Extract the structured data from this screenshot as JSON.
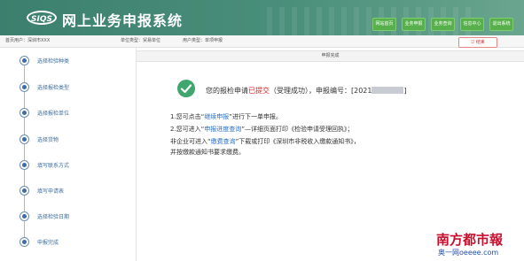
{
  "header": {
    "logo_text": "SIQS",
    "title": "网上业务申报系统",
    "buttons": [
      "网站首页",
      "业务申报",
      "业务查询",
      "信息中心",
      "退出系统"
    ]
  },
  "subbar": {
    "items": [
      "首页用户：深圳市XXX",
      "单位类型：贸易单位",
      "用户类型：单项申报"
    ],
    "exit_label": "结束"
  },
  "sidebar": {
    "steps": [
      "选择检验种类",
      "选择报检类型",
      "选择报检单位",
      "选择货物",
      "填写联系方式",
      "填写申请表",
      "选择检验日期",
      "申报完成"
    ]
  },
  "main": {
    "panel_title": "申报完成",
    "result_prefix": "您的报检申请",
    "result_status": "已提交",
    "result_mid": "（受理成功），申报编号：[2021",
    "result_suffix": "]",
    "info_1_a": "1.您可点击“",
    "info_1_link": "继续申报",
    "info_1_b": "”进行下一单申报。",
    "info_2_a": "2.您可进入“",
    "info_2_link": "申报进度查询",
    "info_2_b": "”—详细页面打印《检验申请受理回执》；",
    "info_3_a": "非企业可进入“",
    "info_3_link": "缴费查询",
    "info_3_b": "”下载或打印《深圳市非税收入缴款通知书》，",
    "info_4": "并按缴款通知书要求缴费。"
  },
  "watermark": {
    "line1": "南方都市報",
    "line2": "奥一网oeeee.com"
  },
  "colors": {
    "header_bg": "#3c7f6e",
    "header_button": "#57b04c",
    "status_red": "#dd2222",
    "link_blue": "#2a6ec7",
    "success_green": "#3fa66f"
  }
}
